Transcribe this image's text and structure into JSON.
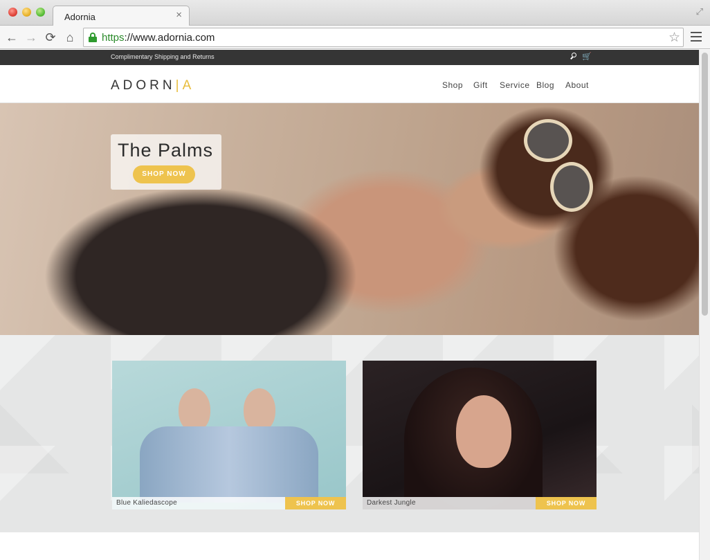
{
  "browser": {
    "tab_title": "Adornia",
    "tab_close": "×",
    "url_scheme": "https",
    "url_rest": "://www.adornia.com",
    "back_icon": "arrow-left",
    "forward_icon": "arrow-right",
    "reload_icon": "reload",
    "home_icon": "home"
  },
  "topbar": {
    "shipping_text": "Complimentary Shipping and Returns",
    "cart_glyph": "🛒"
  },
  "header": {
    "logo_main": "ADORN",
    "logo_bar": "|",
    "logo_accent": "A",
    "nav": [
      "Shop",
      "Gift",
      "Service",
      "Blog",
      "About"
    ]
  },
  "hero": {
    "title": "The Palms",
    "button": "SHOP NOW"
  },
  "promos": [
    {
      "label": "Blue Kaliedascope",
      "button": "SHOP NOW"
    },
    {
      "label": "Darkest Jungle",
      "button": "SHOP NOW"
    }
  ],
  "colors": {
    "accent": "#eec34e",
    "topbar": "#353535"
  }
}
